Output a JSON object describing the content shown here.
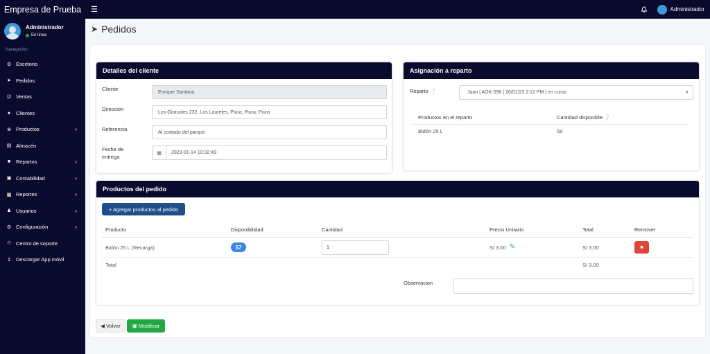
{
  "header": {
    "brand": "Empresa de Prueba",
    "user": "Administrador",
    "menu_icon": "hamburger-icon",
    "bell_icon": "bell-icon"
  },
  "sidebar": {
    "user_name": "Administrador",
    "user_status": "En línea",
    "nav_label": "Navegación",
    "items": [
      {
        "label": "Escritorio",
        "icon": "dashboard-icon"
      },
      {
        "label": "Pedidos",
        "icon": "rocket-icon"
      },
      {
        "label": "Ventas",
        "icon": "check-square-icon"
      },
      {
        "label": "Clientes",
        "icon": "users-icon"
      },
      {
        "label": "Productos",
        "icon": "circle-plus-icon"
      },
      {
        "label": "Almacén",
        "icon": "file-icon"
      },
      {
        "label": "Repartos",
        "icon": "truck-icon"
      },
      {
        "label": "Contabilidad",
        "icon": "money-icon"
      },
      {
        "label": "Reportes",
        "icon": "chart-icon"
      },
      {
        "label": "Usuarios",
        "icon": "user-icon"
      },
      {
        "label": "Configuración",
        "icon": "cogs-icon"
      },
      {
        "label": "Centro de soporte",
        "icon": "globe-icon"
      },
      {
        "label": "Descargar App móvil",
        "icon": "download-icon"
      }
    ]
  },
  "page": {
    "title": "Pedidos"
  },
  "cliente": {
    "title": "Detalles del cliente",
    "cliente_label": "Cliente",
    "cliente_value": "Enrique Santana",
    "direccion_label": "Direccion",
    "direccion_value": "Los Girasoles 232, Los Laureles, Piura, Piura, Piura",
    "referencia_label": "Referencia",
    "referencia_value": "Al costado del parque",
    "fecha_label_1": "Fecha de",
    "fecha_label_2": "entrega",
    "fecha_value": "2023-01-14 10:32:49"
  },
  "reparto": {
    "title": "Asignación a reparto",
    "label": "Reparto",
    "selected": "Juan | AOK-596 | 26/01/23 2:12 PM | en curso",
    "col_productos": "Productos en el reparto",
    "col_cantidad": "Cantidad disponible",
    "rows": [
      {
        "producto": "Bidón 25 L",
        "cantidad": "58"
      }
    ]
  },
  "productos": {
    "title": "Productos del pedido",
    "add_button": "+ Agregar productos al pedido",
    "headers": {
      "producto": "Producto",
      "disponibilidad": "Disponibilidad",
      "cantidad": "Cantidad",
      "precio": "Precio Unitario",
      "total": "Total",
      "remover": "Remover"
    },
    "rows": [
      {
        "producto": "Bidón 25 L (Recarga)",
        "disponibilidad": "57",
        "cantidad": "1",
        "precio": "S/ 3.00",
        "total": "S/ 3.00"
      }
    ],
    "total_label": "Total",
    "total_value": "S/ 3.00",
    "observacion_label": "Observacion",
    "observacion_value": ""
  },
  "actions": {
    "back": "Volver",
    "save": "Modificar"
  },
  "colors": {
    "sidebar": "#0a0a2e",
    "primary": "#1f4f8a",
    "success": "#1fa843",
    "danger": "#e0453b",
    "badge": "#3a86e8"
  }
}
